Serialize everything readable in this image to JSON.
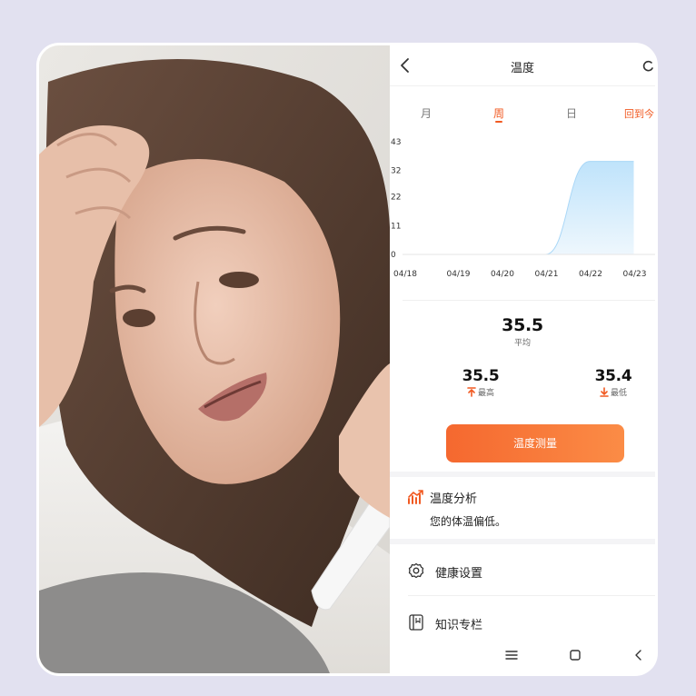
{
  "header": {
    "title": "温度"
  },
  "tabs": [
    {
      "label": "月",
      "active": false
    },
    {
      "label": "周",
      "active": true
    },
    {
      "label": "日",
      "active": false
    }
  ],
  "back_to_today_label": "回到今",
  "chart_data": {
    "type": "area",
    "x": [
      "04/18",
      "04/19",
      "04/20",
      "04/21",
      "04/22",
      "04/23"
    ],
    "y_ticks": [
      0,
      11,
      22,
      32,
      43
    ],
    "ylim": [
      0,
      43
    ],
    "series": [
      {
        "values": [
          0,
          0,
          0,
          0,
          35.5,
          35.5
        ]
      }
    ],
    "fill_color": "#bfe3fb",
    "grid": false
  },
  "stats": {
    "average": {
      "value": "35.5",
      "label": "平均"
    },
    "max": {
      "value": "35.5",
      "label": "最高"
    },
    "min": {
      "value": "35.4",
      "label": "最低"
    }
  },
  "measure_button": {
    "label": "温度测量"
  },
  "analysis": {
    "title": "温度分析",
    "text": "您的体温偏低。"
  },
  "menu": [
    {
      "label": "健康设置",
      "icon": "gear-icon"
    },
    {
      "label": "知识专栏",
      "icon": "book-icon"
    }
  ],
  "colors": {
    "accent": "#f15a22",
    "background": "#e2e1f0",
    "chart_fill": "#bfe3fb"
  }
}
